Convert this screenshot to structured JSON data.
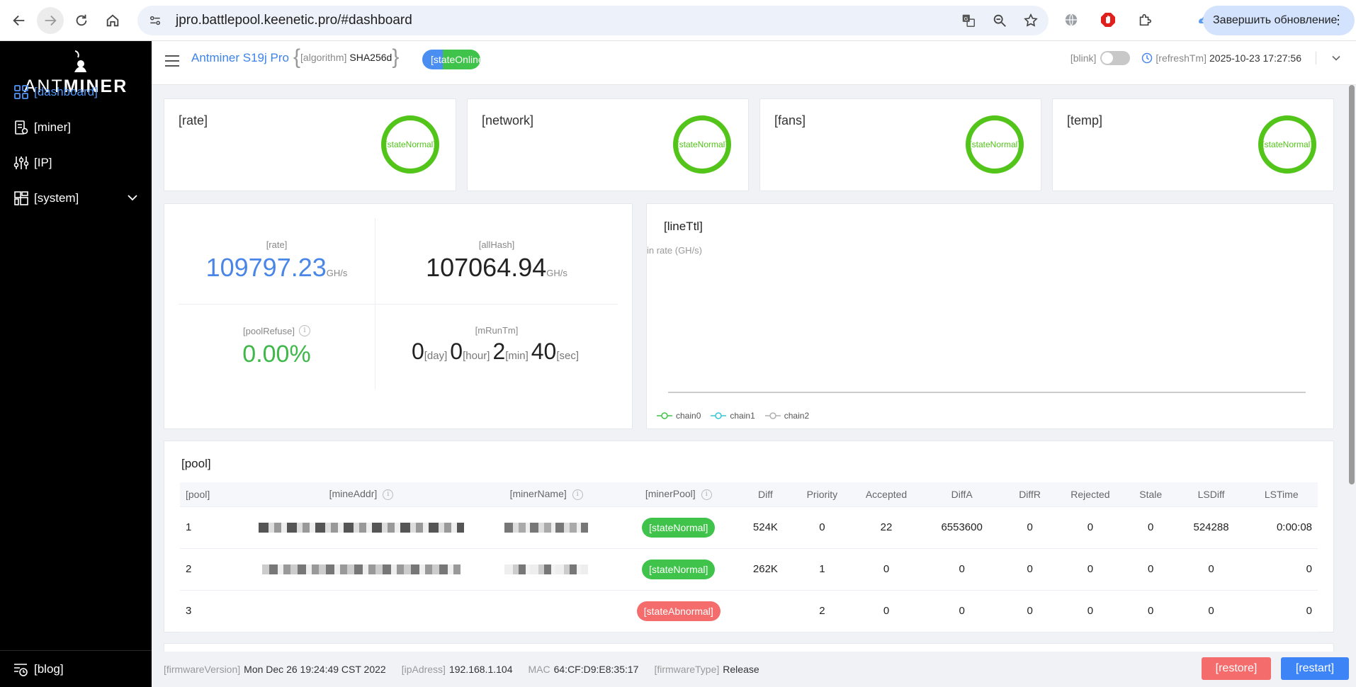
{
  "browser": {
    "url": "jpro.battlepool.keenetic.pro/#dashboard",
    "update_label": "Завершить обновление"
  },
  "sidebar": {
    "brand_light": "ANT",
    "brand_bold": "MINER",
    "items": [
      {
        "label": "[dashboard]",
        "icon": "dashboard-icon"
      },
      {
        "label": "[miner]",
        "icon": "miner-icon"
      },
      {
        "label": "[IP]",
        "icon": "sliders-icon"
      },
      {
        "label": "[system]",
        "icon": "system-icon"
      }
    ],
    "blog": "[blog]"
  },
  "header": {
    "model": "Antminer S19j Pro",
    "algo_label": "[algorithm]",
    "algo_value": "SHA256d",
    "state": "[stateOnline]",
    "blink": "[blink]",
    "refresh_label": "[refreshTm]",
    "refresh_time": "2025-10-23 17:27:56"
  },
  "stat_cards": [
    {
      "title": "[rate]",
      "state": "[stateNormal]"
    },
    {
      "title": "[network]",
      "state": "[stateNormal]"
    },
    {
      "title": "[fans]",
      "state": "[stateNormal]"
    },
    {
      "title": "[temp]",
      "state": "[stateNormal]"
    }
  ],
  "summary": {
    "rate_label": "[rate]",
    "rate_value": "109797.23",
    "rate_unit": "GH/s",
    "allhash_label": "[allHash]",
    "allhash_value": "107064.94",
    "allhash_unit": "GH/s",
    "refuse_label": "[poolRefuse]",
    "refuse_value": "0.00%",
    "runtime_label": "[mRunTm]",
    "runtime": {
      "day": "0",
      "day_u": "[day]",
      "hour": "0",
      "hour_u": "[hour]",
      "min": "2",
      "min_u": "[min]",
      "sec": "40",
      "sec_u": "[sec]"
    }
  },
  "chart": {
    "title": "[lineTtl]",
    "ylabel": "in rate (GH/s)",
    "legend": [
      {
        "name": "chain0",
        "color": "#3fc34a"
      },
      {
        "name": "chain1",
        "color": "#36c6d3"
      },
      {
        "name": "chain2",
        "color": "#b0b0b0"
      }
    ]
  },
  "chart_data": {
    "type": "line",
    "title": "[lineTtl]",
    "ylabel": "in rate (GH/s)",
    "series": [
      {
        "name": "chain0",
        "values": []
      },
      {
        "name": "chain1",
        "values": []
      },
      {
        "name": "chain2",
        "values": []
      }
    ]
  },
  "pool": {
    "title": "[pool]",
    "headers": [
      "[pool]",
      "[mineAddr]",
      "[minerName]",
      "[minerPool]",
      "Diff",
      "Priority",
      "Accepted",
      "DiffA",
      "DiffR",
      "Rejected",
      "Stale",
      "LSDiff",
      "LSTime"
    ],
    "rows": [
      {
        "pool": "1",
        "state": "[stateNormal]",
        "diff": "524K",
        "priority": "0",
        "accepted": "22",
        "diffa": "6553600",
        "diffr": "0",
        "rejected": "0",
        "stale": "0",
        "lsdiff": "524288",
        "lstime": "0:00:08"
      },
      {
        "pool": "2",
        "state": "[stateNormal]",
        "diff": "262K",
        "priority": "1",
        "accepted": "0",
        "diffa": "0",
        "diffr": "0",
        "rejected": "0",
        "stale": "0",
        "lsdiff": "0",
        "lstime": "0"
      },
      {
        "pool": "3",
        "state": "[stateAbnormal]",
        "diff": "",
        "priority": "2",
        "accepted": "0",
        "diffa": "0",
        "diffr": "0",
        "rejected": "0",
        "stale": "0",
        "lsdiff": "0",
        "lstime": "0"
      }
    ]
  },
  "footer": {
    "fw_label": "[firmwareVersion]",
    "fw_value": "Mon Dec 26 19:24:49 CST 2022",
    "ip_label": "[ipAdress]",
    "ip_value": "192.168.1.104",
    "mac_label": "MAC",
    "mac_value": "64:CF:D9:E8:35:17",
    "fwtype_label": "[firmwareType]",
    "fwtype_value": "Release",
    "restore": "[restore]",
    "restart": "[restart]"
  }
}
